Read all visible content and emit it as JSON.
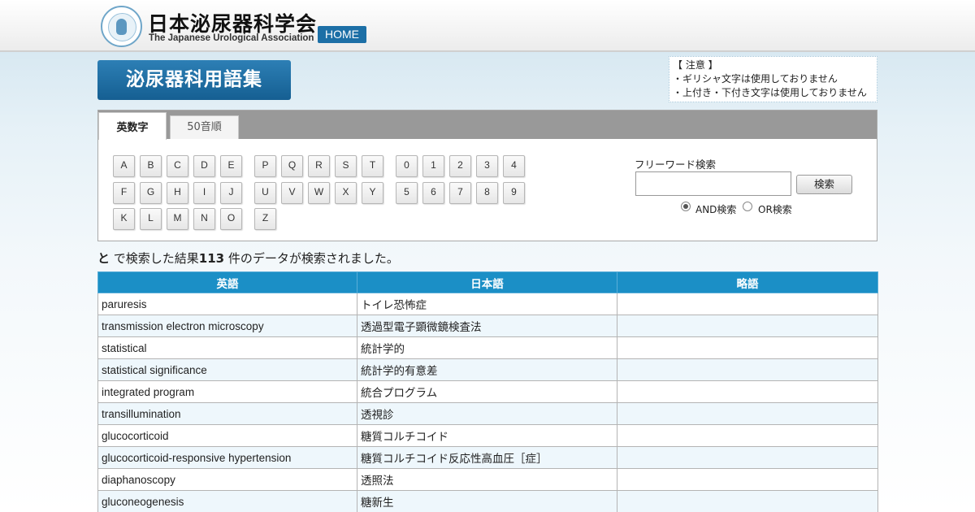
{
  "header": {
    "title": "日本泌尿器科学会",
    "subtitle": "The Japanese Urological Association",
    "home_label": "HOME"
  },
  "banner": {
    "title": "泌尿器科用語集"
  },
  "notice": {
    "heading": "【 注意 】",
    "lines": [
      "・ギリシャ文字は使用しておりません",
      "・上付き・下付き文字は使用しておりません"
    ]
  },
  "tabs": [
    {
      "label": "英数字",
      "active": true
    },
    {
      "label": "50音順",
      "active": false
    }
  ],
  "letter_keys": [
    "A",
    "B",
    "C",
    "D",
    "E",
    "P",
    "Q",
    "R",
    "S",
    "T",
    "F",
    "G",
    "H",
    "I",
    "J",
    "U",
    "V",
    "W",
    "X",
    "Y",
    "K",
    "L",
    "M",
    "N",
    "O",
    "Z"
  ],
  "digit_keys": [
    "0",
    "1",
    "2",
    "3",
    "4",
    "5",
    "6",
    "7",
    "8",
    "9"
  ],
  "freeword": {
    "label": "フリーワード検索",
    "value": "",
    "button": "検索",
    "options": [
      {
        "label": "AND検索",
        "checked": true
      },
      {
        "label": "OR検索",
        "checked": false
      }
    ]
  },
  "result": {
    "query": "と",
    "text_before": " で検索した結果",
    "count": "113",
    "text_after": " 件のデータが検索されました。"
  },
  "table": {
    "headers": [
      "英語",
      "日本語",
      "略語"
    ],
    "rows": [
      [
        "paruresis",
        "トイレ恐怖症",
        ""
      ],
      [
        "transmission electron microscopy",
        "透過型電子顕微鏡検査法",
        ""
      ],
      [
        "statistical",
        "統計学的",
        ""
      ],
      [
        "statistical significance",
        "統計学的有意差",
        ""
      ],
      [
        "integrated program",
        "統合プログラム",
        ""
      ],
      [
        "transillumination",
        "透視診",
        ""
      ],
      [
        "glucocorticoid",
        "糖質コルチコイド",
        ""
      ],
      [
        "glucocorticoid-responsive hypertension",
        "糖質コルチコイド反応性高血圧［症］",
        ""
      ],
      [
        "diaphanoscopy",
        "透照法",
        ""
      ],
      [
        "gluconeogenesis",
        "糖新生",
        ""
      ]
    ]
  }
}
